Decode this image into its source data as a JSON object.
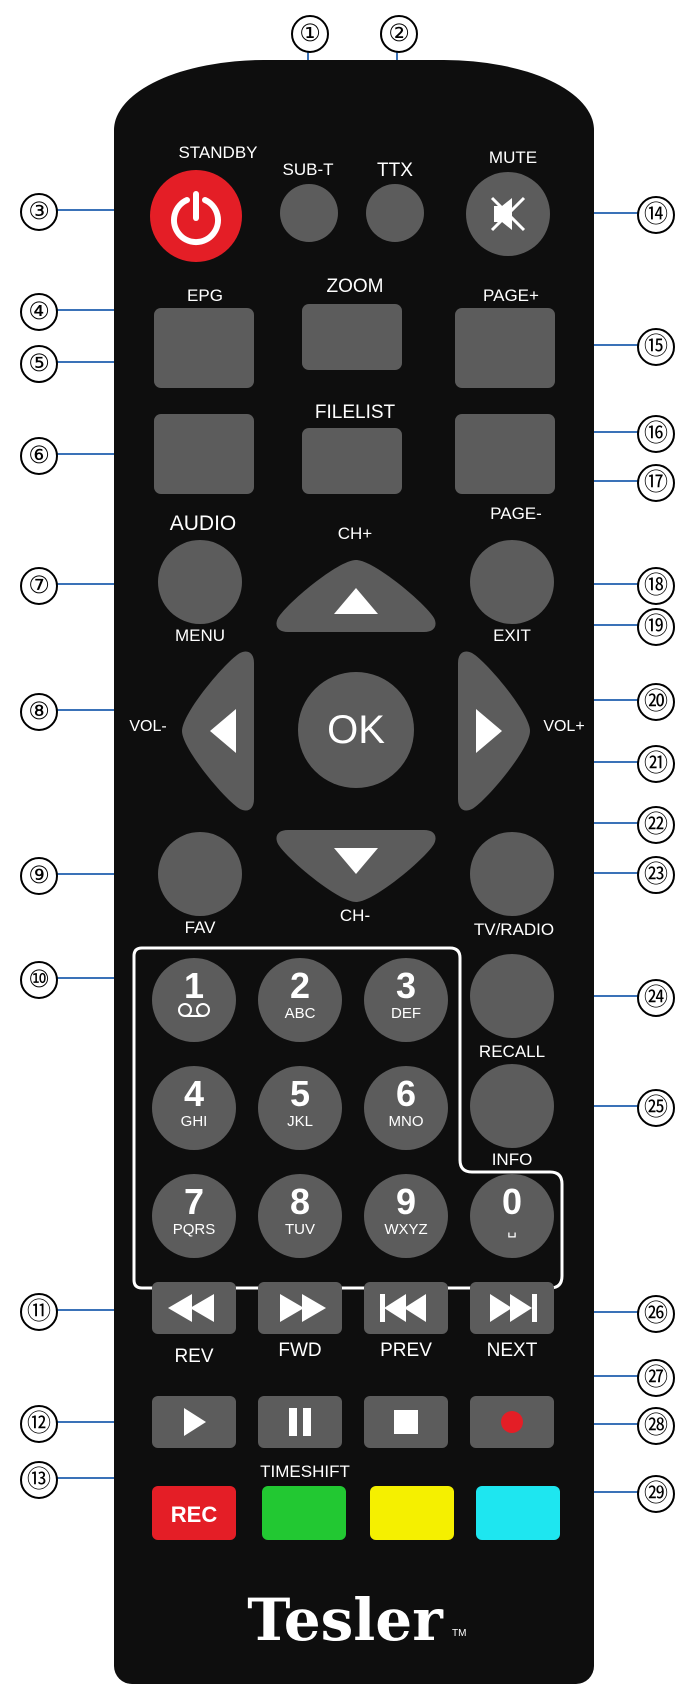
{
  "brand": "Tesler",
  "brand_tm": "TM",
  "labels": {
    "standby": "STANDBY",
    "sub_t": "SUB-T",
    "ttx": "TTX",
    "mute": "MUTE",
    "epg": "EPG",
    "zoom": "ZOOM",
    "page_plus": "PAGE+",
    "filelist": "FILELIST",
    "audio": "AUDIO",
    "ch_plus": "CH+",
    "page_minus": "PAGE-",
    "menu": "MENU",
    "exit": "EXIT",
    "vol_minus": "VOL-",
    "ok": "OK",
    "vol_plus": "VOL+",
    "fav": "FAV",
    "ch_minus": "CH-",
    "tv_radio": "TV/RADIO",
    "recall": "RECALL",
    "info": "INFO",
    "rev": "REV",
    "fwd": "FWD",
    "prev": "PREV",
    "next": "NEXT",
    "timeshift": "TIMESHIFT",
    "rec": "REC"
  },
  "numpad": [
    {
      "digit": "1",
      "sub": "oo"
    },
    {
      "digit": "2",
      "sub": "ABC"
    },
    {
      "digit": "3",
      "sub": "DEF"
    },
    {
      "digit": "4",
      "sub": "GHI"
    },
    {
      "digit": "5",
      "sub": "JKL"
    },
    {
      "digit": "6",
      "sub": "MNO"
    },
    {
      "digit": "7",
      "sub": "PQRS"
    },
    {
      "digit": "8",
      "sub": "TUV"
    },
    {
      "digit": "9",
      "sub": "WXYZ"
    },
    {
      "digit": "0",
      "sub": "␣"
    }
  ],
  "callouts": {
    "c1": "①",
    "c2": "②",
    "c3": "③",
    "c4": "④",
    "c5": "⑤",
    "c6": "⑥",
    "c7": "⑦",
    "c8": "⑧",
    "c9": "⑨",
    "c10": "⑩",
    "c11": "⑪",
    "c12": "⑫",
    "c13": "⑬",
    "c14": "⑭",
    "c15": "⑮",
    "c16": "⑯",
    "c17": "⑰",
    "c18": "⑱",
    "c19": "⑲",
    "c20": "⑳",
    "c21": "㉑",
    "c22": "㉒",
    "c23": "㉓",
    "c24": "㉔",
    "c25": "㉕",
    "c26": "㉖",
    "c27": "㉗",
    "c28": "㉘",
    "c29": "㉙"
  },
  "colors": {
    "body": "#0e0e0e",
    "button": "#5c5c5c",
    "standby": "#e41e26",
    "rec": "#e41e26",
    "green": "#22c832",
    "yellow": "#f5f000",
    "cyan": "#1ee6f0",
    "record_dot": "#e41e26"
  },
  "icons": {
    "standby": "power-icon",
    "mute": "mute-icon",
    "up": "arrow-up-icon",
    "down": "arrow-down-icon",
    "left": "arrow-left-icon",
    "right": "arrow-right-icon",
    "rewind": "rewind-icon",
    "forward": "fast-forward-icon",
    "prev": "skip-back-icon",
    "next": "skip-forward-icon",
    "play": "play-icon",
    "pause": "pause-icon",
    "stop": "stop-icon",
    "record": "record-icon"
  }
}
